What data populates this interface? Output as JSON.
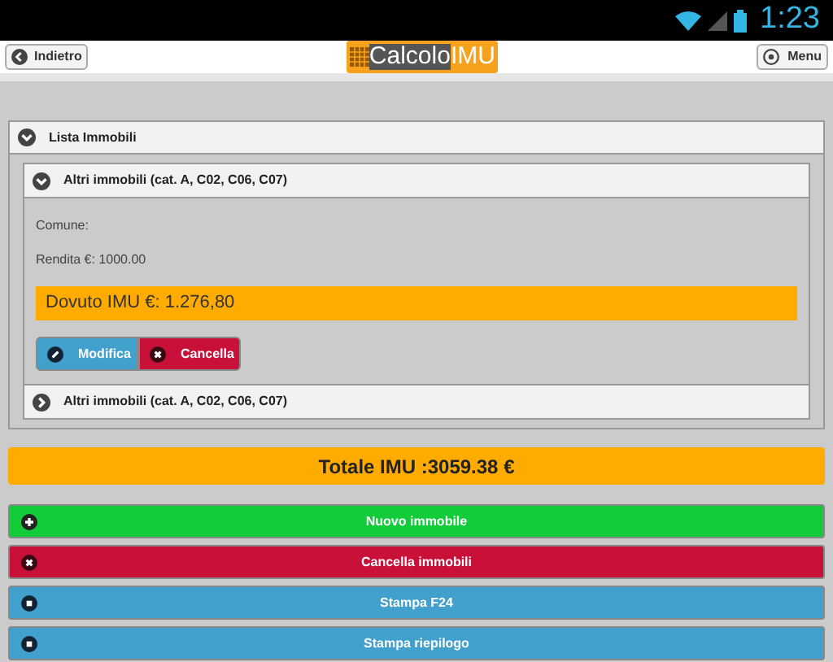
{
  "status_bar": {
    "time": "1:23"
  },
  "header": {
    "back_button": "Indietro",
    "logo": {
      "part_1": "Calcolo",
      "part_2": "IMU"
    },
    "menu_button": "Menu"
  },
  "list": {
    "title": "Lista Immobili",
    "expanded": true,
    "items": [
      {
        "title": "Altri immobili (cat. A, C02, C06, C07)",
        "expanded": true,
        "fields": [
          "Comune:",
          "Rendita €: 1000.00"
        ],
        "due": "Dovuto IMU €: 1.276,80",
        "actions": [
          {
            "label": "Modifica",
            "kind": "edit"
          },
          {
            "label": "Cancella",
            "kind": "delete"
          }
        ]
      },
      {
        "title": "Altri immobili (cat. A, C02, C06, C07)",
        "expanded": false
      }
    ]
  },
  "total": "Totale IMU :3059.38 €",
  "actions": [
    {
      "label": "Nuovo immobile",
      "kind": "add"
    },
    {
      "label": "Cancella immobili",
      "kind": "delete"
    },
    {
      "label": "Stampa F24",
      "kind": "print"
    },
    {
      "label": "Stampa riepilogo",
      "kind": "print"
    }
  ]
}
